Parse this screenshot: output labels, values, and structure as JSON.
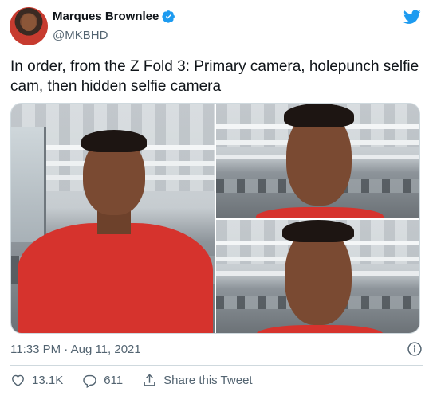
{
  "author": {
    "name": "Marques Brownlee",
    "handle": "@MKBHD"
  },
  "tweet": {
    "text": "In order, from the Z Fold 3: Primary camera, holepunch selfie cam, then hidden selfie camera"
  },
  "meta": {
    "timestamp": "11:33 PM · Aug 11, 2021"
  },
  "actions": {
    "likes": "13.1K",
    "replies": "611",
    "share_label": "Share this Tweet"
  },
  "colors": {
    "brand": "#1d9bf0",
    "text": "#0f1419",
    "muted": "#536471",
    "border": "#cfd9de"
  },
  "icons": [
    "verified-badge-icon",
    "twitter-bird-icon",
    "info-icon",
    "heart-icon",
    "reply-icon",
    "share-icon"
  ]
}
